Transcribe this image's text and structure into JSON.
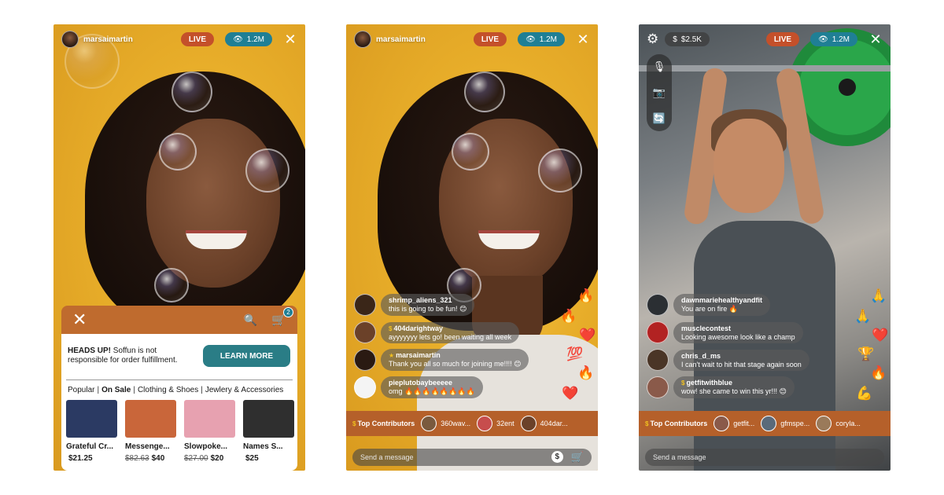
{
  "screens": [
    {
      "username": "marsaimartin",
      "live_label": "LIVE",
      "views": "1.2M",
      "shop": {
        "notice_bold": "HEADS UP!",
        "notice_text": "Soffun is not responsible for order fulfillment.",
        "cart_count": "2",
        "learn_more": "LEARN MORE",
        "categories": [
          "Popular",
          "On Sale",
          "Clothing & Shoes",
          "Jewlery & Accessories"
        ],
        "active_category": "On Sale",
        "products": [
          {
            "name": "Grateful Cr...",
            "old_price": "",
            "price": "$21.25",
            "color": "#2b3a63"
          },
          {
            "name": "Messenge...",
            "old_price": "$82.63",
            "price": "$40",
            "color": "#c9663a"
          },
          {
            "name": "Slowpoke...",
            "old_price": "$27.00",
            "price": "$20",
            "color": "#e7a1b0"
          },
          {
            "name": "Names S...",
            "old_price": "",
            "price": "$25",
            "color": "#2f2f2f"
          }
        ]
      }
    },
    {
      "username": "marsaimartin",
      "live_label": "LIVE",
      "views": "1.2M",
      "chat": [
        {
          "user": "shrimp_aliens_321",
          "text": "this is going to be fun! 😊",
          "badge": "",
          "avatar": "#3a2618"
        },
        {
          "user": "404darightway",
          "text": "ayyyyyyy lets go! been waiting all week",
          "badge": "coin",
          "avatar": "#6b4129"
        },
        {
          "user": "marsaimartin",
          "text": "Thank you all so much for joining me!!!! 😊",
          "badge": "star",
          "avatar": "#2a1a12"
        },
        {
          "user": "pieplutobaybeeeee",
          "text": "omg 🔥🔥🔥🔥🔥🔥🔥🔥",
          "badge": "",
          "avatar": "#f4f4f4"
        }
      ],
      "reactions": [
        "🔥",
        "🔥",
        "❤️",
        "💯",
        "🔥",
        "❤️"
      ],
      "contributors_label": "Top Contributors",
      "contributors": [
        {
          "name": "360wav...",
          "avatar": "#7a5a3e"
        },
        {
          "name": "32ent",
          "avatar": "#c74d4d"
        },
        {
          "name": "404dar...",
          "avatar": "#6b4129"
        }
      ],
      "message_placeholder": "Send a message"
    },
    {
      "coins": "$2.5K",
      "live_label": "LIVE",
      "views": "1.2M",
      "chat": [
        {
          "user": "dawnmariehealthyandfit",
          "text": "You are on fire 🔥",
          "badge": "",
          "avatar": "#2b2f33"
        },
        {
          "user": "musclecontest",
          "text": "Looking awesome look like a champ",
          "badge": "",
          "avatar": "#b22222"
        },
        {
          "user": "chris_d_ms",
          "text": "I can't wait to hit that stage again soon",
          "badge": "",
          "avatar": "#4a3526"
        },
        {
          "user": "getfitwithblue",
          "text": "wow! she came to win this yr!!! 😊",
          "badge": "coin",
          "avatar": "#8a5a4a"
        }
      ],
      "reactions": [
        "🙏",
        "🙏",
        "❤️",
        "🏆",
        "🔥",
        "💪"
      ],
      "contributors_label": "Top Contributors",
      "contributors": [
        {
          "name": "getfit...",
          "avatar": "#8a5a4a"
        },
        {
          "name": "gfmspe...",
          "avatar": "#5a6a7a"
        },
        {
          "name": "coryla...",
          "avatar": "#9a7a5a"
        }
      ],
      "message_placeholder": "Send a message"
    }
  ],
  "icons": {
    "eye": "👁",
    "close": "✕",
    "search": "🔍",
    "cart": "🛒",
    "gear": "⚙",
    "mic_off": "🎙",
    "camera_off": "📷",
    "switch": "🔄",
    "coin": "$"
  },
  "colors": {
    "live": "#c4502a",
    "views": "#1f7f95",
    "shop_bar": "#bf6b2e",
    "learn_more": "#2a7d86",
    "contributors_bar": "#b5602a"
  }
}
